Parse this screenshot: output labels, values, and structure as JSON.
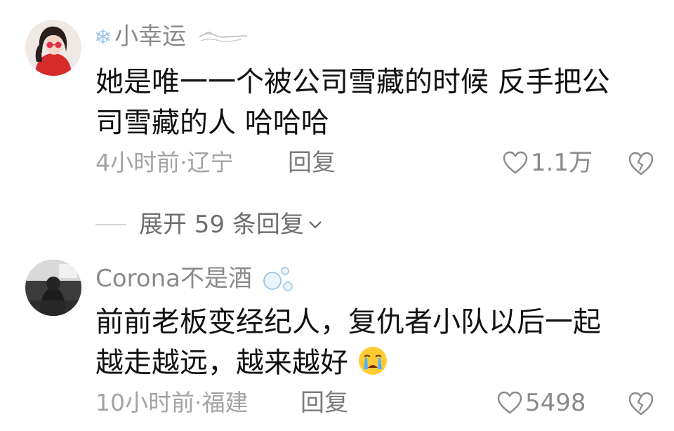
{
  "comments": [
    {
      "username": "小幸运",
      "text_lines": [
        "她是唯一一个被公司雪藏的时候 反手把公",
        "司雪藏的人 哈哈哈"
      ],
      "time": "4小时前",
      "location": "辽宁",
      "reply_label": "回复",
      "likes": "1.1万",
      "username_decorations": [
        "snowflake-icon",
        "wind-swirl-icon"
      ]
    },
    {
      "username": "Corona不是酒",
      "text_lines": [
        "前前老板变经纪人，复仇者小队以后一起",
        "越走越远，越来越好"
      ],
      "time": "10小时前",
      "location": "福建",
      "reply_label": "回复",
      "likes": "5498",
      "username_decorations": [
        "bubbles-icon"
      ],
      "inline_emoji": "crying-face-icon"
    }
  ],
  "expand_replies": "展开 59 条回复",
  "meta_separator": "·",
  "colors": {
    "meta": "#a3a3a3",
    "username": "#8a8a8a",
    "text": "#111111",
    "divider": "#d6d6d6"
  }
}
